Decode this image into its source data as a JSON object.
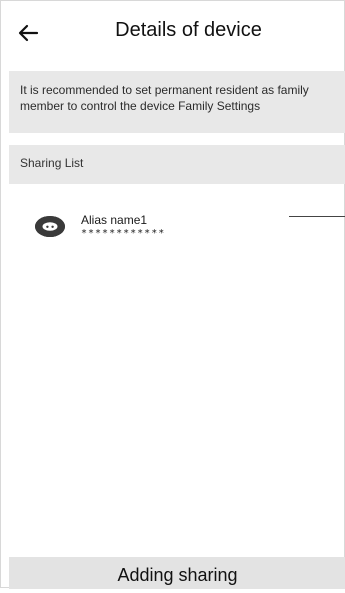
{
  "header": {
    "title": "Details of device",
    "back_icon": "arrow-left-icon"
  },
  "notice": {
    "text": "It is recommended to set permanent resident as family member to control the device Family Settings"
  },
  "sharing_list": {
    "label": "Sharing List",
    "items": [
      {
        "alias": "Alias name1",
        "masked": "************",
        "icon": "device-avatar-icon"
      }
    ]
  },
  "actions": {
    "adding_sharing": "Adding sharing"
  }
}
